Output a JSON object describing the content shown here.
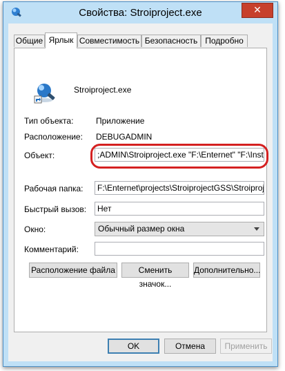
{
  "window": {
    "title": "Свойства: Stroiproject.exe",
    "close_glyph": "✕"
  },
  "tabs": [
    {
      "label": "Общие",
      "active": false
    },
    {
      "label": "Ярлык",
      "active": true
    },
    {
      "label": "Совместимость",
      "active": false
    },
    {
      "label": "Безопасность",
      "active": false
    },
    {
      "label": "Подробно",
      "active": false
    }
  ],
  "shortcut": {
    "name": "Stroiproject.exe",
    "icon": "shortcut-app-icon"
  },
  "fields": {
    "type_label": "Тип объекта:",
    "type_value": "Приложение",
    "location_label": "Расположение:",
    "location_value": "DEBUGADMIN",
    "target_label": "Объект:",
    "target_value": ";ADMIN\\Stroiproject.exe \"F:\\Enternet\" \"F:\\Install\"",
    "workdir_label": "Рабочая папка:",
    "workdir_value": "F:\\Enternet\\projects\\StroiprojectGSS\\Stroiproject\\",
    "hotkey_label": "Быстрый вызов:",
    "hotkey_value": "Нет",
    "window_label": "Окно:",
    "window_value": "Обычный размер окна",
    "comment_label": "Комментарий:",
    "comment_value": ""
  },
  "buttons": {
    "open_location": "Расположение файла",
    "change_icon": "Сменить значок...",
    "advanced": "Дополнительно...",
    "ok": "OK",
    "cancel": "Отмена",
    "apply": "Применить"
  },
  "annotation": {
    "color": "#d42020"
  }
}
